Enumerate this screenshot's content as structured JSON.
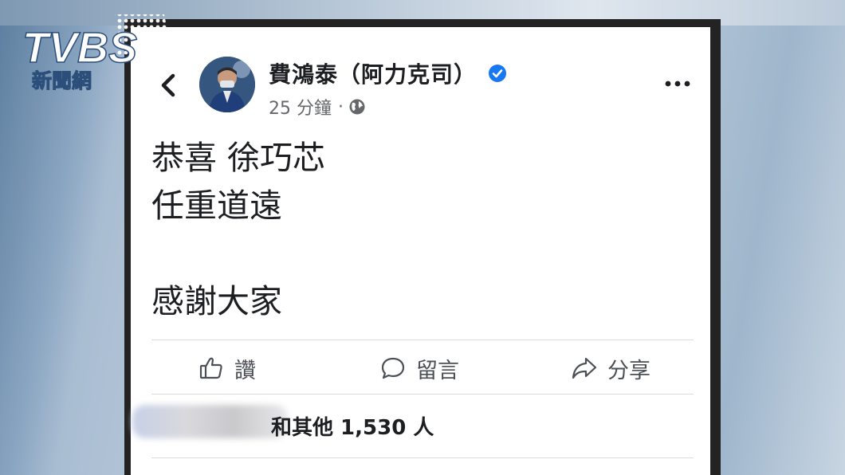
{
  "logo": {
    "brand": "TVBS",
    "subtitle": "新聞網"
  },
  "post": {
    "author": "費鴻泰（阿力克司）",
    "time": "25 分鐘",
    "separator": "·",
    "lines": [
      "恭喜 徐巧芯",
      "任重道遠",
      "",
      "感謝大家"
    ],
    "actions": {
      "like": "讚",
      "comment": "留言",
      "share": "分享"
    },
    "reactions_text": "和其他 1,530 人"
  },
  "icons": [
    "back-icon",
    "verified-icon",
    "globe-icon",
    "more-icon",
    "like-icon",
    "comment-icon",
    "share-icon"
  ],
  "colors": {
    "verified": "#1877f2",
    "text": "#1c1e21",
    "secondary": "#65676b"
  }
}
